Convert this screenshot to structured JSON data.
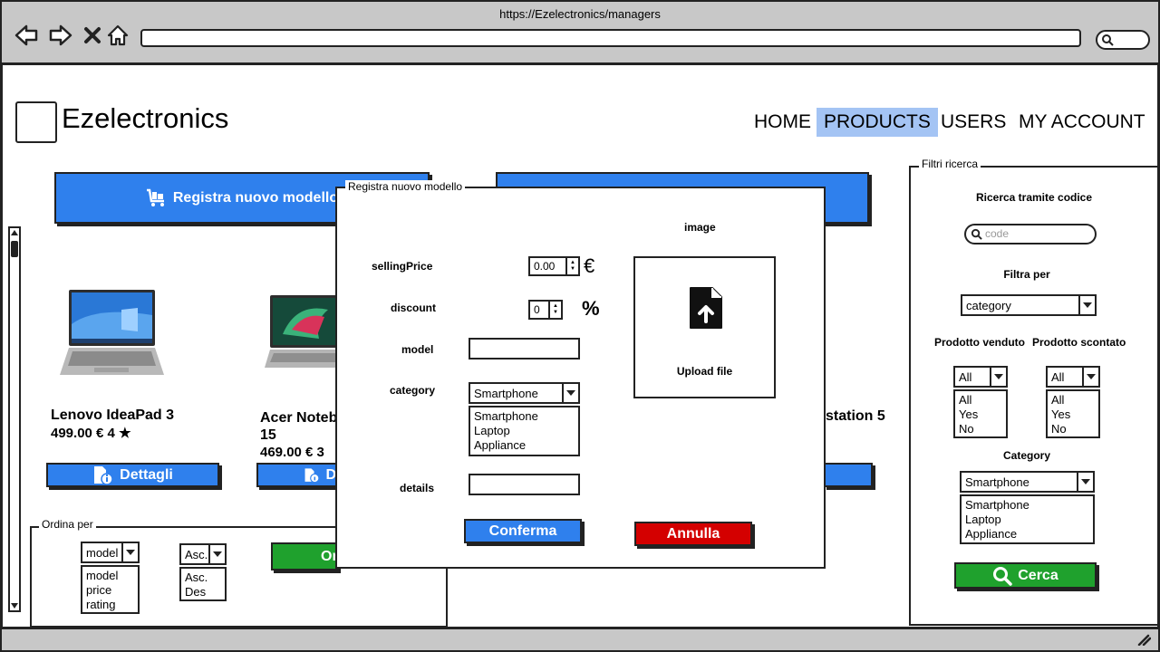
{
  "browser": {
    "url": "https://Ezelectronics/managers"
  },
  "header": {
    "brand": "Ezelectronics",
    "nav": [
      {
        "label": "HOME"
      },
      {
        "label": "PRODUCTS"
      },
      {
        "label": "USERS"
      },
      {
        "label": "MY ACCOUNT"
      }
    ]
  },
  "toolbar": {
    "register_label": "Registra nuovo modello"
  },
  "products": [
    {
      "name": "Lenovo IdeaPad 3",
      "price": "499.00 € 4 ★",
      "details_label": "Dettagli"
    },
    {
      "name": "Acer Notebo",
      "name2": "15",
      "price": "469.00 € 3",
      "details_label": "D"
    },
    {
      "name_fragment": "station 5"
    }
  ],
  "sort": {
    "title": "Ordina per",
    "field_selected": "model",
    "field_options": [
      "model",
      "price",
      "rating"
    ],
    "order_selected": "Asc.",
    "order_options": [
      "Asc.",
      "Des"
    ],
    "button_label": "Or"
  },
  "filters": {
    "title": "Filtri ricerca",
    "code_search_label": "Ricerca tramite codice",
    "code_placeholder": "code",
    "filter_by_label": "Filtra per",
    "filter_by_selected": "category",
    "sold_label": "Prodotto venduto",
    "discounted_label": "Prodotto scontato",
    "sold_selected": "All",
    "sold_options": [
      "All",
      "Yes",
      "No"
    ],
    "discounted_selected": "All",
    "discounted_options": [
      "All",
      "Yes",
      "No"
    ],
    "category_label": "Category",
    "category_selected": "Smartphone",
    "category_options": [
      "Smartphone",
      "Laptop",
      "Appliance"
    ],
    "search_label": "Cerca"
  },
  "modal": {
    "title": "Registra nuovo modello",
    "selling_price_label": "sellingPrice",
    "selling_price_value": "0.00",
    "currency": "€",
    "discount_label": "discount",
    "discount_value": "0",
    "percent": "%",
    "model_label": "model",
    "category_label": "category",
    "category_selected": "Smartphone",
    "category_options": [
      "Smartphone",
      "Laptop",
      "Appliance"
    ],
    "details_label": "details",
    "image_label": "image",
    "upload_label": "Upload file",
    "confirm_label": "Conferma",
    "cancel_label": "Annulla"
  },
  "colors": {
    "primary": "#2f80ed",
    "nav_active": "#a4c4f4",
    "success": "#1fa12d",
    "danger": "#d40000",
    "chrome": "#c8c8c8"
  }
}
